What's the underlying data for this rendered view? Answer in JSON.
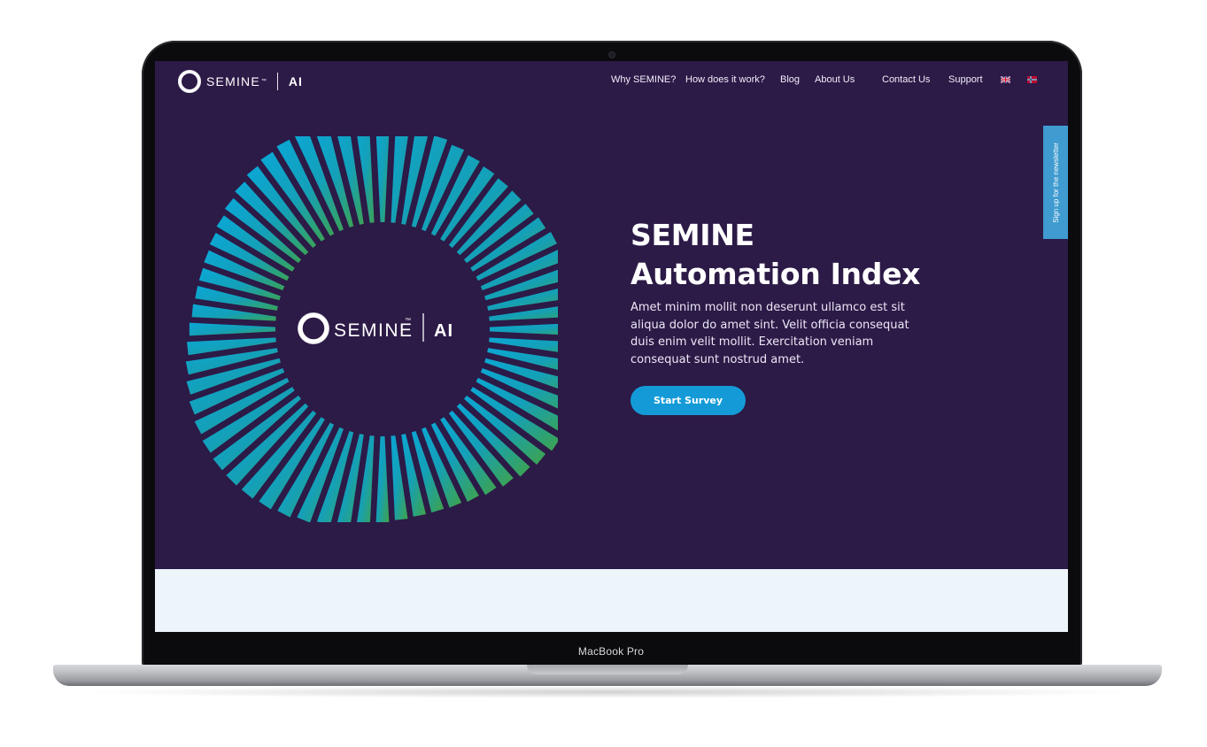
{
  "device": {
    "bezel_label": "MacBook Pro"
  },
  "brand": {
    "name": "SEMINE",
    "tm": "™",
    "suffix": "AI",
    "icon": "semine-ring-logo"
  },
  "nav": {
    "links": [
      {
        "label": "Why SEMINE?"
      },
      {
        "label": "How does it work?"
      },
      {
        "label": "Blog"
      },
      {
        "label": "About Us"
      },
      {
        "label": "Contact Us"
      },
      {
        "label": "Support"
      }
    ],
    "languages": [
      {
        "icon": "uk-flag-icon"
      },
      {
        "icon": "norway-flag-icon"
      }
    ]
  },
  "newsletter": {
    "label": "Sign up for the newsletter"
  },
  "hero": {
    "title": "SEMINE Automation Index",
    "body": "Amet minim mollit non deserunt ullamco est sit aliqua dolor do amet sint. Velit officia consequat duis enim velit mollit. Exercitation veniam consequat sunt nostrud amet.",
    "cta_label": "Start Survey",
    "graphic_logo": {
      "name": "SEMINE",
      "tm": "™",
      "suffix": "AI"
    }
  },
  "colors": {
    "page_bg": "#2c1a47",
    "accent_blue": "#149bd7",
    "newsletter_tab": "#3f9bd0",
    "burst_start": "#0aa7d6",
    "burst_end": "#3fa34a",
    "lower_section": "#edf5fb"
  }
}
